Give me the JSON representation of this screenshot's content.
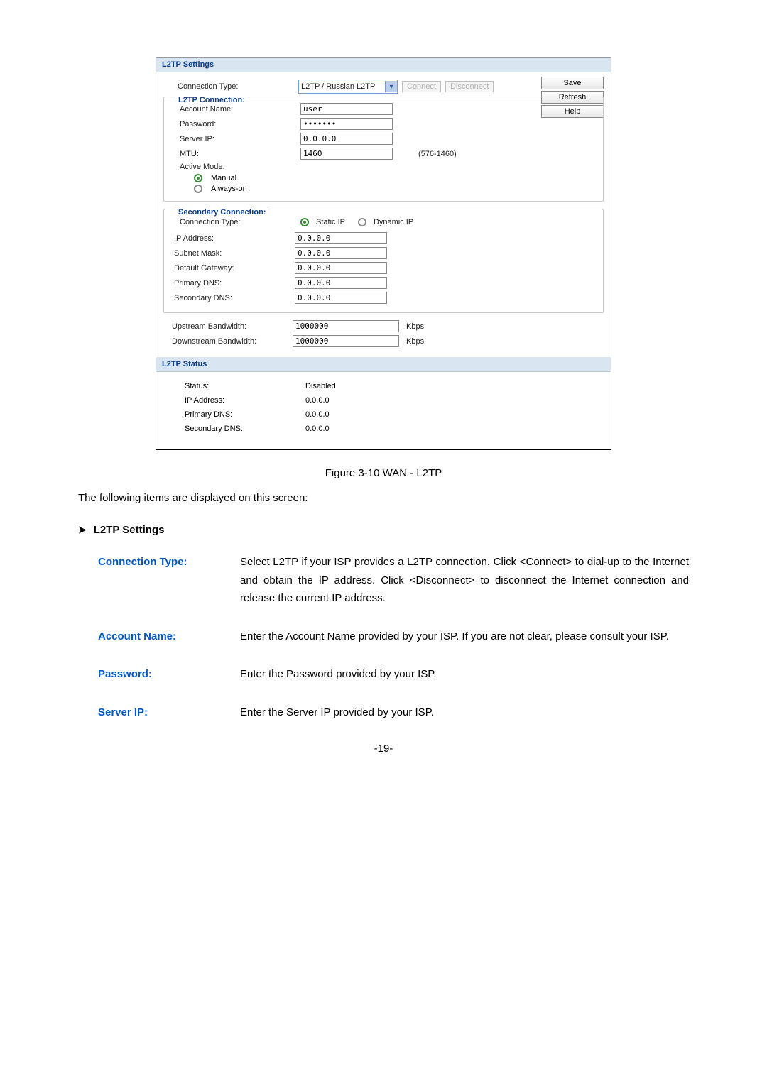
{
  "router": {
    "sections": {
      "settings_header": "L2TP Settings",
      "status_header": "L2TP Status"
    },
    "side_buttons": {
      "save": "Save",
      "refresh": "Refresh",
      "help": "Help"
    },
    "connection_type": {
      "label": "Connection Type:",
      "value": "L2TP / Russian L2TP",
      "connect_btn": "Connect",
      "disconnect_btn": "Disconnect"
    },
    "l2tp_conn": {
      "title": "L2TP Connection:",
      "account_label": "Account Name:",
      "account_value": "user",
      "password_label": "Password:",
      "password_value": "•••••••",
      "server_label": "Server IP:",
      "server_value": "0.0.0.0",
      "mtu_label": "MTU:",
      "mtu_value": "1460",
      "mtu_hint": "(576-1460)",
      "active_mode_label": "Active Mode:",
      "mode_manual": "Manual",
      "mode_always": "Always-on"
    },
    "secondary": {
      "title": "Secondary Connection:",
      "conn_type_label": "Connection Type:",
      "static_ip": "Static IP",
      "dynamic_ip": "Dynamic IP",
      "ip_label": "IP Address:",
      "ip_value": "0.0.0.0",
      "subnet_label": "Subnet Mask:",
      "subnet_value": "0.0.0.0",
      "gateway_label": "Default Gateway:",
      "gateway_value": "0.0.0.0",
      "pdns_label": "Primary DNS:",
      "pdns_value": "0.0.0.0",
      "sdns_label": "Secondary DNS:",
      "sdns_value": "0.0.0.0"
    },
    "bandwidth": {
      "up_label": "Upstream Bandwidth:",
      "up_value": "1000000",
      "down_label": "Downstream Bandwidth:",
      "down_value": "1000000",
      "unit": "Kbps"
    },
    "status": {
      "status_label": "Status:",
      "status_value": "Disabled",
      "ip_label": "IP Address:",
      "ip_value": "0.0.0.0",
      "pdns_label": "Primary DNS:",
      "pdns_value": "0.0.0.0",
      "sdns_label": "Secondary DNS:",
      "sdns_value": "0.0.0.0"
    }
  },
  "caption": "Figure 3-10 WAN - L2TP",
  "intro": "The following items are displayed on this screen:",
  "bullet_heading": "L2TP Settings",
  "descriptions": {
    "connection_type": {
      "label": "Connection Type:",
      "text": "Select L2TP if your ISP provides a L2TP connection. Click <Connect> to dial-up to the Internet and obtain the IP address. Click <Disconnect> to disconnect the Internet connection and release the current IP address."
    },
    "account_name": {
      "label": "Account Name:",
      "text": "Enter the Account Name provided by your ISP. If you are not clear, please consult your ISP."
    },
    "password": {
      "label": "Password:",
      "text": "Enter the Password provided by your ISP."
    },
    "server_ip": {
      "label": "Server IP:",
      "text": "Enter the Server IP provided by your ISP."
    }
  },
  "page_number": "-19-"
}
